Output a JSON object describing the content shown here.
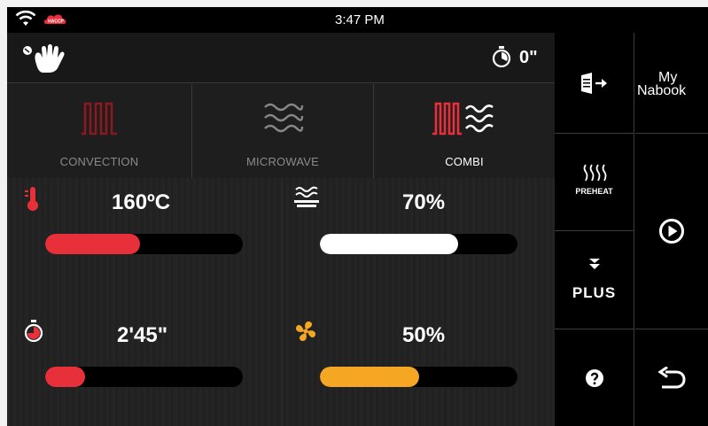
{
  "status_bar": {
    "time": "3:47 PM",
    "haccp_label": "HACCP",
    "icons": [
      "wifi-icon",
      "haccp-badge"
    ]
  },
  "info_bar": {
    "timer_value": "0\"",
    "icons": [
      "hand-touch-icon",
      "stopwatch-icon"
    ]
  },
  "modes": [
    {
      "label": "CONVECTION",
      "state": "inactive",
      "icon": "convection-icon"
    },
    {
      "label": "MICROWAVE",
      "state": "inactive",
      "icon": "microwave-icon"
    },
    {
      "label": "COMBI",
      "state": "selected",
      "icon": "combi-icon"
    }
  ],
  "controls": {
    "temperature": {
      "value": "160ºC",
      "level": 0.48,
      "color": "#e8303a",
      "icon": "thermometer-icon"
    },
    "microwave_power": {
      "value": "70%",
      "level": 0.7,
      "color": "#ffffff",
      "icon": "microwave-power-icon"
    },
    "time": {
      "value": "2'45\"",
      "level": 0.2,
      "color": "#e8303a",
      "icon": "stopwatch-icon"
    },
    "fan": {
      "value": "50%",
      "level": 0.5,
      "color": "#f5a623",
      "icon": "fan-icon"
    }
  },
  "sidebar": {
    "my_nabook": {
      "line1": "My",
      "line2": "Nabook"
    },
    "preheat_label": "PREHEAT",
    "plus_label": "PLUS",
    "icons": [
      "door-exit-icon",
      "preheat-icon",
      "plus-down-icon",
      "help-icon",
      "play-icon",
      "back-icon"
    ]
  },
  "colors": {
    "accent_red": "#e8303a",
    "accent_orange": "#f5a623",
    "inactive_text": "#8a8a8a"
  }
}
